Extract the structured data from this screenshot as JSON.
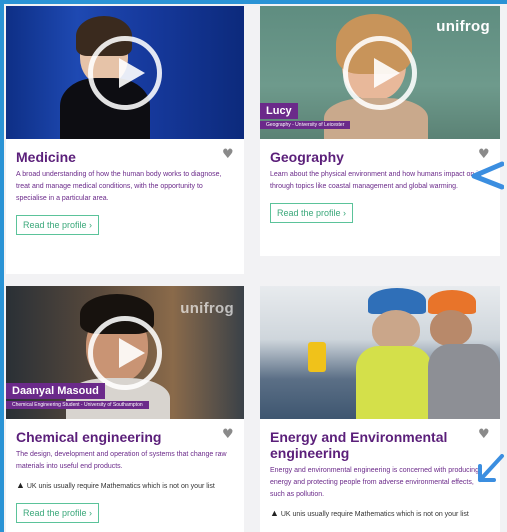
{
  "brand": "unifrog",
  "read_label": "Read the profile",
  "cards": [
    {
      "title": "Medicine",
      "description": "A broad understanding of how the human body works to diagnose, treat and manage medical conditions, with the opportunity to specialise in a particular area."
    },
    {
      "title": "Geography",
      "description": "Learn about the physical environment and how humans impact on it, through topics like coastal management and global warming.",
      "video_name": "Lucy",
      "video_sub": "Geography - University of Leicester"
    },
    {
      "title": "Chemical engineering",
      "description": "The design, development and operation of systems that change raw materials into useful end products.",
      "notice": "UK unis usually require Mathematics which is not on your list",
      "video_name": "Daanyal Masoud",
      "video_sub": "Chemical Engineering Student - University of Southampton"
    },
    {
      "title": "Energy and Environmental engineering",
      "description": "Energy and environmental engineering is concerned with producing energy and protecting people from adverse environmental effects, such as pollution.",
      "notice": "UK unis usually require Mathematics which is not on your list"
    }
  ],
  "colors": {
    "title": "#5b1f7a",
    "button_border": "#5bc39a",
    "frame": "#2a93d5",
    "arrow": "#3b8ee0"
  }
}
